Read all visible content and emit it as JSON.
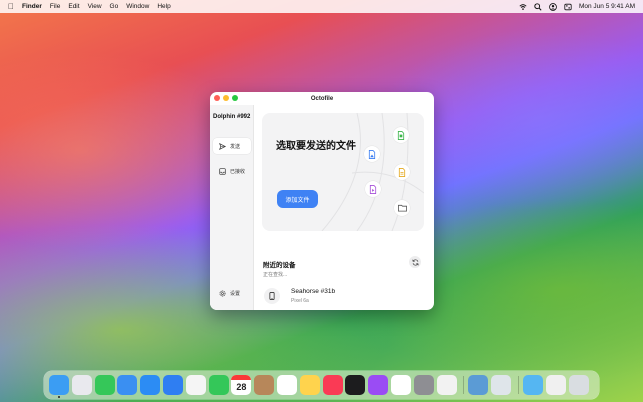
{
  "menubar": {
    "app_name": "Finder",
    "menus": [
      "File",
      "Edit",
      "View",
      "Go",
      "Window",
      "Help"
    ],
    "datetime": "Mon Jun 5  9:41 AM"
  },
  "window": {
    "title": "Octofile",
    "sidebar": {
      "device_name": "Dolphin #992",
      "nav": [
        {
          "label": "发送",
          "icon": "send-icon",
          "active": true
        },
        {
          "label": "已接收",
          "icon": "inbox-icon",
          "active": false
        }
      ],
      "settings_label": "设置"
    },
    "main": {
      "drop_title": "选取要发送的文件",
      "add_button": "添加文件",
      "nearby_title": "附近的设备",
      "searching": "正在查找...",
      "peers": [
        {
          "name": "Seahorse #31b",
          "model": "Pixel 6a"
        }
      ]
    }
  },
  "dock": {
    "apps": [
      {
        "name": "Finder",
        "color": "#3b9df3",
        "running": true
      },
      {
        "name": "Launchpad",
        "color": "#e9e9ee"
      },
      {
        "name": "Messages",
        "color": "#35c759"
      },
      {
        "name": "Mail",
        "color": "#3a8ff2"
      },
      {
        "name": "Safari",
        "color": "#2c8cf4"
      },
      {
        "name": "App Store",
        "color": "#2f7ef2"
      },
      {
        "name": "Photos",
        "color": "#f5f5f5"
      },
      {
        "name": "FaceTime",
        "color": "#34c759"
      },
      {
        "name": "Calendar",
        "color": "#ffffff",
        "day": "28"
      },
      {
        "name": "Contacts",
        "color": "#b7875a"
      },
      {
        "name": "Reminders",
        "color": "#ffffff"
      },
      {
        "name": "Notes",
        "color": "#ffd34d"
      },
      {
        "name": "Music",
        "color": "#fa3a55"
      },
      {
        "name": "TV",
        "color": "#1c1c1e"
      },
      {
        "name": "Podcasts",
        "color": "#9a4cf4"
      },
      {
        "name": "News",
        "color": "#ffffff"
      },
      {
        "name": "System Settings",
        "color": "#8e8e93"
      },
      {
        "name": "Pages",
        "color": "#f2f2f2"
      },
      {
        "name": "Preview",
        "color": "#5b9bd5"
      },
      {
        "name": "Octofile",
        "color": "#dfe5ea"
      },
      {
        "name": "Downloads",
        "color": "#55b6f2"
      },
      {
        "name": "Documents",
        "color": "#f0f0f0"
      },
      {
        "name": "Trash",
        "color": "#d9dde1"
      }
    ]
  }
}
